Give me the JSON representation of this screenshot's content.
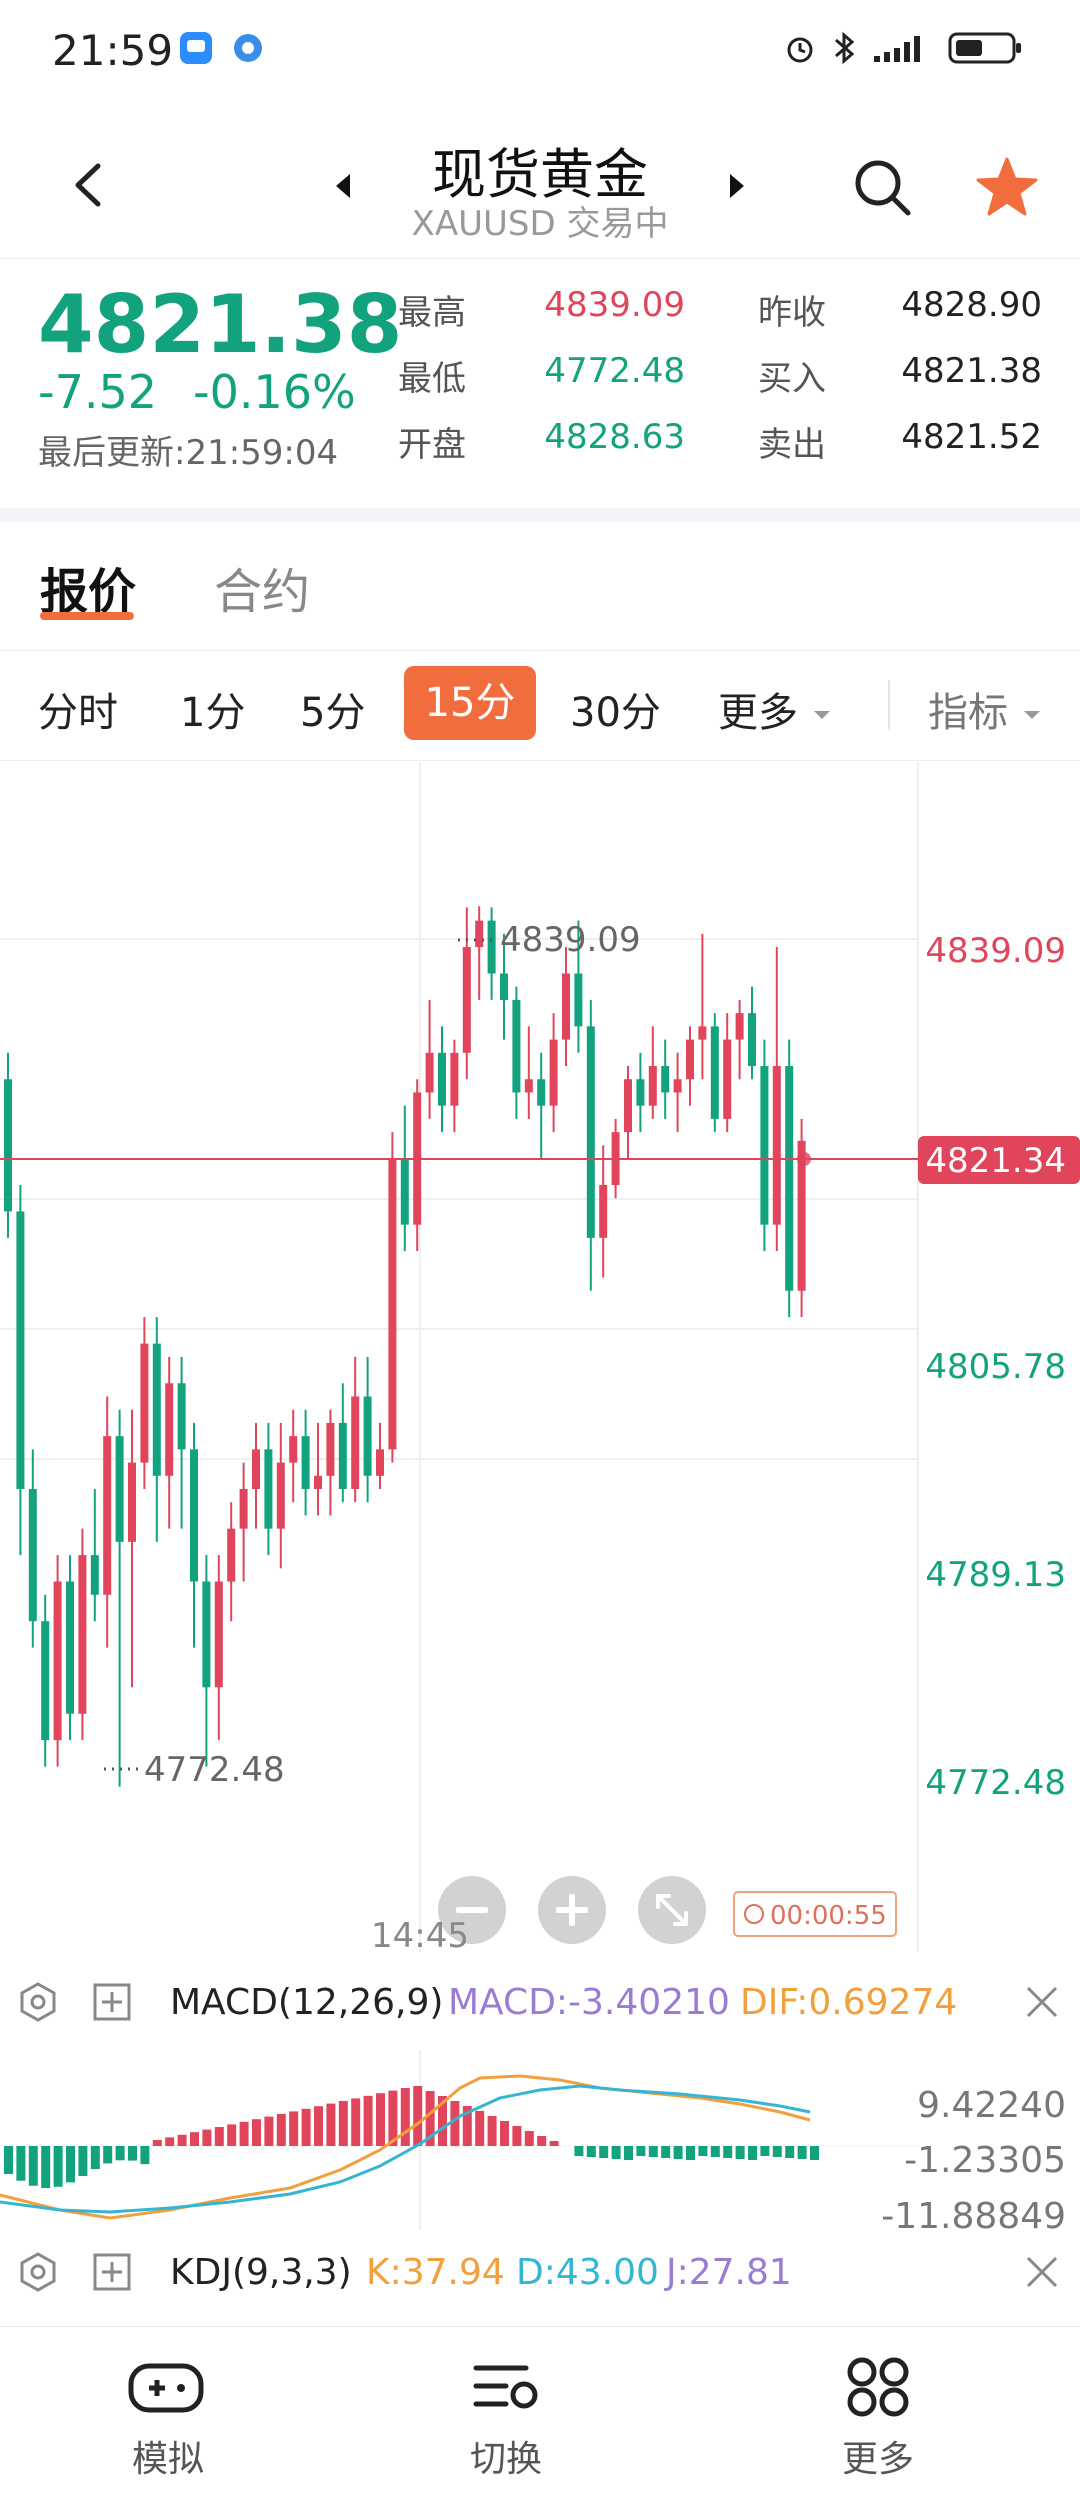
{
  "status_bar": {
    "time": "21:59"
  },
  "header": {
    "title": "现货黄金",
    "subtitle": "XAUUSD 交易中"
  },
  "quote": {
    "price": "4821.38",
    "change": "-7.52",
    "change_pct": "-0.16%",
    "last_update": "最后更新:21:59:04",
    "stats": [
      {
        "label": "最高",
        "value": "4839.09",
        "color": "#e0455b"
      },
      {
        "label": "最低",
        "value": "4772.48",
        "color": "#12a37e"
      },
      {
        "label": "开盘",
        "value": "4828.63",
        "color": "#12a37e"
      },
      {
        "label": "昨收",
        "value": "4828.90",
        "color": "#222222"
      },
      {
        "label": "买入",
        "value": "4821.38",
        "color": "#222222"
      },
      {
        "label": "卖出",
        "value": "4821.52",
        "color": "#222222"
      }
    ]
  },
  "tabs": [
    {
      "label": "报价"
    },
    {
      "label": "合约"
    }
  ],
  "periods": [
    "分时",
    "1分",
    "5分",
    "15分",
    "30分",
    "更多"
  ],
  "indicator_menu": "指标",
  "chart": {
    "price_labels": [
      "4839.09",
      "4821.34",
      "4805.78",
      "4789.13",
      "4772.48"
    ],
    "high_label": "4839.09",
    "low_label": "4772.48",
    "time_label": "14:45",
    "countdown": "00:00:55",
    "colors": {
      "up": "#e0455b",
      "down": "#12a37e",
      "grid": "#efefef",
      "current": "#e0455b"
    }
  },
  "chart_data": {
    "type": "candlestick",
    "ylim": [
      4763,
      4850
    ],
    "candles": [
      {
        "o": 4826,
        "h": 4828,
        "c": 4816,
        "l": 4814
      },
      {
        "o": 4816,
        "h": 4818,
        "c": 4795,
        "l": 4790
      },
      {
        "o": 4795,
        "h": 4798,
        "c": 4785,
        "l": 4783
      },
      {
        "o": 4785,
        "h": 4787,
        "c": 4776,
        "l": 4774
      },
      {
        "o": 4776,
        "h": 4790,
        "c": 4788,
        "l": 4774
      },
      {
        "o": 4788,
        "h": 4790,
        "c": 4778,
        "l": 4776
      },
      {
        "o": 4778,
        "h": 4792,
        "c": 4790,
        "l": 4776
      },
      {
        "o": 4790,
        "h": 4795,
        "c": 4787,
        "l": 4785
      },
      {
        "o": 4787,
        "h": 4802,
        "c": 4799,
        "l": 4783
      },
      {
        "o": 4799,
        "h": 4801,
        "c": 4791,
        "l": 4772.48
      },
      {
        "o": 4791,
        "h": 4801,
        "c": 4797,
        "l": 4780
      },
      {
        "o": 4797,
        "h": 4808,
        "c": 4806,
        "l": 4795
      },
      {
        "o": 4806,
        "h": 4808,
        "c": 4796,
        "l": 4791
      },
      {
        "o": 4796,
        "h": 4805,
        "c": 4803,
        "l": 4792
      },
      {
        "o": 4803,
        "h": 4805,
        "c": 4798,
        "l": 4792
      },
      {
        "o": 4798,
        "h": 4800,
        "c": 4788,
        "l": 4783
      },
      {
        "o": 4788,
        "h": 4790,
        "c": 4780,
        "l": 4774
      },
      {
        "o": 4780,
        "h": 4790,
        "c": 4788,
        "l": 4776
      },
      {
        "o": 4788,
        "h": 4794,
        "c": 4792,
        "l": 4785
      },
      {
        "o": 4792,
        "h": 4797,
        "c": 4795,
        "l": 4788
      },
      {
        "o": 4795,
        "h": 4800,
        "c": 4798,
        "l": 4792
      },
      {
        "o": 4798,
        "h": 4800,
        "c": 4792,
        "l": 4790
      },
      {
        "o": 4792,
        "h": 4800,
        "c": 4797,
        "l": 4789
      },
      {
        "o": 4797,
        "h": 4801,
        "c": 4799,
        "l": 4794
      },
      {
        "o": 4799,
        "h": 4801,
        "c": 4795,
        "l": 4793
      },
      {
        "o": 4795,
        "h": 4800,
        "c": 4796,
        "l": 4793
      },
      {
        "o": 4796,
        "h": 4801,
        "c": 4800,
        "l": 4793
      },
      {
        "o": 4800,
        "h": 4803,
        "c": 4795,
        "l": 4794
      },
      {
        "o": 4795,
        "h": 4805,
        "c": 4802,
        "l": 4794
      },
      {
        "o": 4802,
        "h": 4805,
        "c": 4796,
        "l": 4794
      },
      {
        "o": 4796,
        "h": 4800,
        "c": 4798,
        "l": 4795
      },
      {
        "o": 4798,
        "h": 4822,
        "c": 4820,
        "l": 4797
      },
      {
        "o": 4820,
        "h": 4824,
        "c": 4815,
        "l": 4813
      },
      {
        "o": 4815,
        "h": 4826,
        "c": 4825,
        "l": 4813
      },
      {
        "o": 4825,
        "h": 4832,
        "c": 4828,
        "l": 4823
      },
      {
        "o": 4828,
        "h": 4830,
        "c": 4824,
        "l": 4822
      },
      {
        "o": 4824,
        "h": 4829,
        "c": 4828,
        "l": 4822
      },
      {
        "o": 4828,
        "h": 4839,
        "c": 4836,
        "l": 4826
      },
      {
        "o": 4836,
        "h": 4839.09,
        "c": 4838,
        "l": 4832
      },
      {
        "o": 4838,
        "h": 4839,
        "c": 4834,
        "l": 4832
      },
      {
        "o": 4834,
        "h": 4837,
        "c": 4832,
        "l": 4829
      },
      {
        "o": 4832,
        "h": 4833,
        "c": 4825,
        "l": 4823
      },
      {
        "o": 4825,
        "h": 4830,
        "c": 4826,
        "l": 4823
      },
      {
        "o": 4826,
        "h": 4828,
        "c": 4824,
        "l": 4820
      },
      {
        "o": 4824,
        "h": 4831,
        "c": 4829,
        "l": 4822
      },
      {
        "o": 4829,
        "h": 4836,
        "c": 4834,
        "l": 4827
      },
      {
        "o": 4834,
        "h": 4838,
        "c": 4830,
        "l": 4828
      },
      {
        "o": 4830,
        "h": 4832,
        "c": 4814,
        "l": 4810
      },
      {
        "o": 4814,
        "h": 4821,
        "c": 4818,
        "l": 4811
      },
      {
        "o": 4818,
        "h": 4823,
        "c": 4822,
        "l": 4817
      },
      {
        "o": 4822,
        "h": 4827,
        "c": 4826,
        "l": 4820
      },
      {
        "o": 4826,
        "h": 4828,
        "c": 4824,
        "l": 4822
      },
      {
        "o": 4824,
        "h": 4830,
        "c": 4827,
        "l": 4823
      },
      {
        "o": 4827,
        "h": 4829,
        "c": 4825,
        "l": 4823
      },
      {
        "o": 4825,
        "h": 4828,
        "c": 4826,
        "l": 4822
      },
      {
        "o": 4826,
        "h": 4830,
        "c": 4829,
        "l": 4824
      },
      {
        "o": 4829,
        "h": 4837,
        "c": 4830,
        "l": 4826
      },
      {
        "o": 4830,
        "h": 4831,
        "c": 4823,
        "l": 4822
      },
      {
        "o": 4823,
        "h": 4831,
        "c": 4829,
        "l": 4822
      },
      {
        "o": 4829,
        "h": 4832,
        "c": 4831,
        "l": 4826
      },
      {
        "o": 4831,
        "h": 4833,
        "c": 4827,
        "l": 4826
      },
      {
        "o": 4827,
        "h": 4829,
        "c": 4815,
        "l": 4813
      },
      {
        "o": 4815,
        "h": 4836,
        "c": 4827,
        "l": 4813
      },
      {
        "o": 4827,
        "h": 4829,
        "c": 4810,
        "l": 4808
      },
      {
        "o": 4810,
        "h": 4823,
        "c": 4821.34,
        "l": 4808
      }
    ]
  },
  "macd": {
    "name": "MACD(12,26,9)",
    "macd_label": "MACD:-3.40210",
    "dif_label": "DIF:0.69274",
    "scale": [
      "9.42240",
      "-1.23305",
      "-11.88849"
    ],
    "colors": {
      "macd": "#9b7cd4",
      "dif": "#f0a03c",
      "dea": "#35b5d1"
    }
  },
  "kdj": {
    "name": "KDJ(9,3,3)",
    "k_label": "K:37.94",
    "d_label": "D:43.00",
    "j_label": "J:27.81",
    "colors": {
      "k": "#f0a03c",
      "d": "#35b5d1",
      "j": "#9b7cd4"
    }
  },
  "bottom_nav": [
    {
      "label": "模拟"
    },
    {
      "label": "切换"
    },
    {
      "label": "更多"
    }
  ]
}
